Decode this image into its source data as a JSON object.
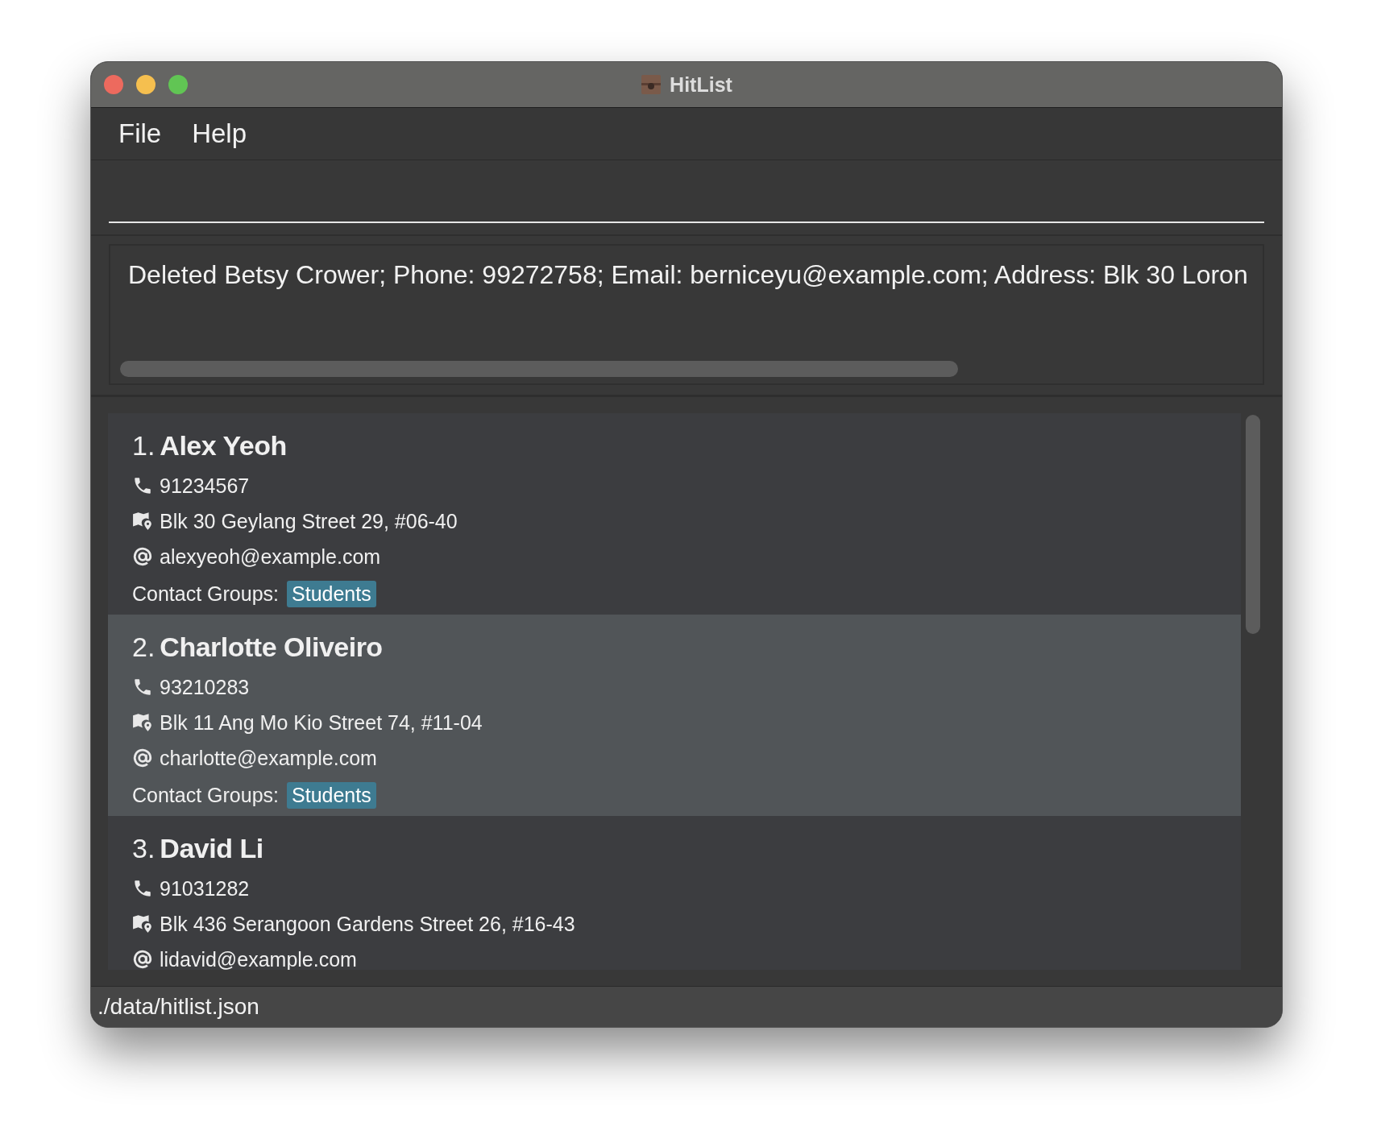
{
  "window": {
    "title": "HitList"
  },
  "menu": [
    {
      "label": "File"
    },
    {
      "label": "Help"
    }
  ],
  "result_display": {
    "text": "Deleted Betsy Crower; Phone: 99272758; Email: berniceyu@example.com; Address: Blk 30 Loron"
  },
  "persons": [
    {
      "index": "1.",
      "name": "Alex Yeoh",
      "phone": "91234567",
      "address": "Blk 30 Geylang Street 29, #06-40",
      "email": "alexyeoh@example.com",
      "groups_label": "Contact Groups:",
      "groups": [
        "Students"
      ],
      "selected": false
    },
    {
      "index": "2.",
      "name": "Charlotte Oliveiro",
      "phone": "93210283",
      "address": "Blk 11 Ang Mo Kio Street 74, #11-04",
      "email": "charlotte@example.com",
      "groups_label": "Contact Groups:",
      "groups": [
        "Students"
      ],
      "selected": true
    },
    {
      "index": "3.",
      "name": "David Li",
      "phone": "91031282",
      "address": "Blk 436 Serangoon Gardens Street 26, #16-43",
      "email": "lidavid@example.com",
      "selected": false
    }
  ],
  "status_bar": {
    "path": "./data/hitlist.json"
  }
}
